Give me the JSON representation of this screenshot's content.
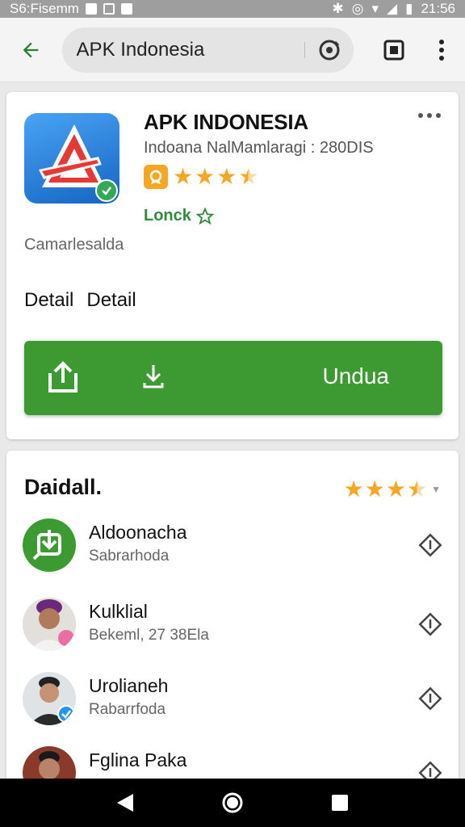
{
  "status_bar": {
    "left_text": "S6:Fisemm",
    "time": "21:56"
  },
  "search": {
    "query": "APK Indonesia"
  },
  "app": {
    "title": "APK INDONESIA",
    "subtitle": "Indoana NalMamlaragi : 280DIS",
    "rating": 3.5,
    "link_label": "Lonck",
    "caption": "Camarlesalda",
    "detail_labels": [
      "Detail",
      "Detail"
    ],
    "install_label": "Undua"
  },
  "reviews_section": {
    "title": "Daidall.",
    "rating": 3.5,
    "items": [
      {
        "name": "Aldoonacha",
        "meta": "Sabrarhoda"
      },
      {
        "name": "Kulklial",
        "meta": "Bekeml, 27 38Ela"
      },
      {
        "name": "Urolianeh",
        "meta": "Rabarrfoda"
      },
      {
        "name": "Fglina Paka",
        "meta": ""
      }
    ]
  },
  "colors": {
    "accent_green": "#3d9a32",
    "star": "#f5a623",
    "back_arrow": "#2e7d32"
  },
  "icons": {
    "back": "arrow-left-icon",
    "lens": "lens-icon",
    "tabs": "tabs-icon",
    "more": "more-vert-icon",
    "share": "share-icon",
    "download": "download-icon",
    "row_action": "diamond-direction-icon"
  }
}
